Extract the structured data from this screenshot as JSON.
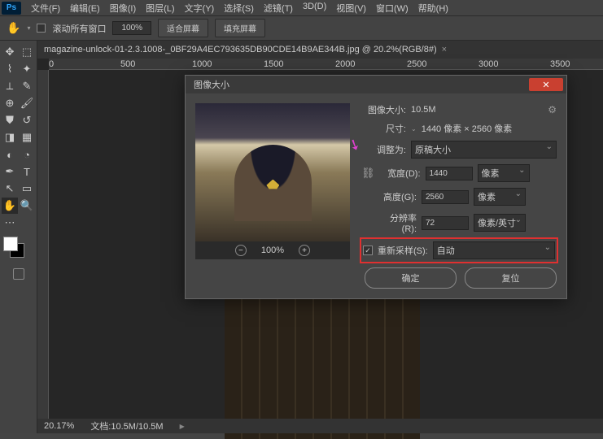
{
  "menu": [
    "文件(F)",
    "编辑(E)",
    "图像(I)",
    "图层(L)",
    "文字(Y)",
    "选择(S)",
    "滤镜(T)",
    "3D(D)",
    "视图(V)",
    "窗口(W)",
    "帮助(H)"
  ],
  "optbar": {
    "scroll_all": "滚动所有窗口",
    "zoom": "100%",
    "btn1": "适合屏幕",
    "btn2": "填充屏幕"
  },
  "tab": {
    "name": "magazine-unlock-01-2.3.1008-_0BF29A4EC793635DB90CDE14B9AE344B.jpg @ 20.2%(RGB/8#)"
  },
  "ruler_marks": [
    "0",
    "500",
    "1000",
    "1500",
    "2000",
    "2500",
    "3000",
    "3500"
  ],
  "status": {
    "zoom": "20.17%",
    "doc": "文档:10.5M/10.5M"
  },
  "dialog": {
    "title": "图像大小",
    "size_label": "图像大小:",
    "size_val": "10.5M",
    "dim_label": "尺寸:",
    "dim_val": "1440 像素 × 2560 像素",
    "fit_label": "调整为:",
    "fit_val": "原稿大小",
    "w_label": "宽度(D):",
    "w_val": "1440",
    "w_unit": "像素",
    "h_label": "高度(G):",
    "h_val": "2560",
    "h_unit": "像素",
    "res_label": "分辨率(R):",
    "res_val": "72",
    "res_unit": "像素/英寸",
    "resample_label": "重新采样(S):",
    "resample_val": "自动",
    "preview_zoom": "100%",
    "ok": "确定",
    "reset": "复位"
  }
}
